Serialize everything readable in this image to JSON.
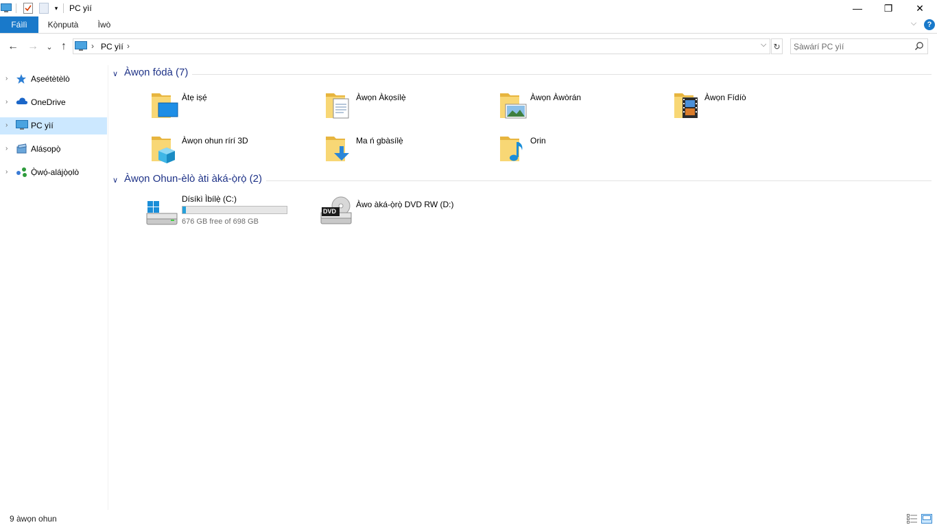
{
  "window": {
    "title": "PC yìí",
    "minimize_label": "—",
    "maximize_label": "❐",
    "close_label": "✕"
  },
  "ribbon": {
    "tabs": [
      "Fáìlì",
      "Kọ̀nputà",
      "Ìwò"
    ],
    "collapse_label": "⌵",
    "help_label": "?"
  },
  "address": {
    "crumb": "PC yìí",
    "chevron": "›",
    "dropdown_label": "⌵",
    "refresh_label": "↻"
  },
  "search": {
    "placeholder": "Ṣàwárí PC yìí"
  },
  "nav": {
    "back_label": "←",
    "forward_label": "→",
    "recent_label": "⌄",
    "up_label": "↑"
  },
  "sidebar": {
    "items": [
      {
        "label": "Aṣeétètèlò",
        "icon": "star-icon"
      },
      {
        "label": "OneDrive",
        "icon": "cloud-icon"
      },
      {
        "label": "PC yìí",
        "icon": "pc-icon",
        "selected": true
      },
      {
        "label": "Aláṣopọ̀",
        "icon": "libraries-icon"
      },
      {
        "label": "Ọ̀wọ́-alájọ̀ọlò",
        "icon": "network-icon"
      }
    ]
  },
  "groups": {
    "folders": {
      "title": "Àwọn fódà (7)",
      "items": [
        {
          "label": "Àtẹ iṣẹ́",
          "icon": "desktop-folder-icon"
        },
        {
          "label": "Àwọn Àkọsílẹ̀",
          "icon": "documents-folder-icon"
        },
        {
          "label": "Àwọn Àwòrán",
          "icon": "pictures-folder-icon"
        },
        {
          "label": "Àwọn Fídíò",
          "icon": "videos-folder-icon"
        },
        {
          "label": "Àwọn ohun rírí 3D",
          "icon": "3d-objects-folder-icon"
        },
        {
          "label": "Ma ń gbàsílẹ̀",
          "icon": "downloads-folder-icon"
        },
        {
          "label": "Orin",
          "icon": "music-folder-icon"
        }
      ]
    },
    "drives": {
      "title": "Àwọn Ohun-èlò àti àká-ọ̀rọ̀ (2)",
      "items": [
        {
          "label": "Dísíkì Ìbílẹ̀ (C:)",
          "free_text": "676 GB free of 698 GB",
          "used_fraction": 0.0315,
          "icon": "local-disk-icon"
        },
        {
          "label": "Àwo àká-ọ̀rọ̀ DVD RW (D:)",
          "icon": "dvd-drive-icon",
          "badge": "DVD"
        }
      ]
    }
  },
  "status": {
    "count": "9 àwọn ohun"
  },
  "colors": {
    "accent": "#1979ca",
    "group_title": "#1e3287",
    "selection": "#cce8ff",
    "folder": "#f8d775",
    "drive_bar": "#26a0da"
  }
}
